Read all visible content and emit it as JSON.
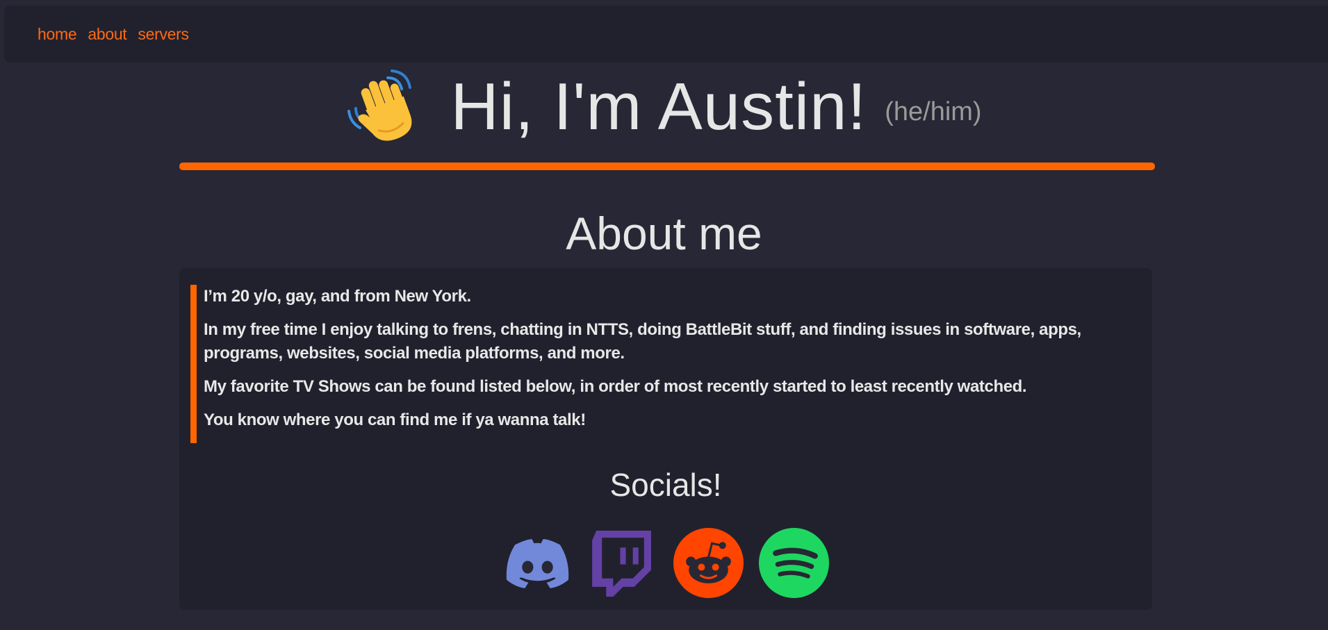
{
  "nav": {
    "items": [
      {
        "label": "home"
      },
      {
        "label": "about"
      },
      {
        "label": "servers"
      }
    ]
  },
  "hero": {
    "title": "Hi, I'm Austin!",
    "pronouns": "(he/him)",
    "emoji_icon": "waving-hand-icon"
  },
  "about": {
    "title": "About me",
    "paragraphs": [
      "I’m 20 y/o, gay, and from New York.",
      "In my free time I enjoy talking to frens, chatting in NTTS, doing BattleBit stuff, and finding issues in software, apps, programs, websites, social media platforms, and more.",
      "My favorite TV Shows can be found listed below, in order of most recently started to least recently watched.",
      "You know where you can find me if ya wanna talk!"
    ]
  },
  "socials": {
    "title": "Socials!",
    "links": [
      {
        "icon": "discord-icon",
        "color": "#7289da"
      },
      {
        "icon": "twitch-icon",
        "color": "#6441a5"
      },
      {
        "icon": "reddit-icon",
        "color": "#ff4500"
      },
      {
        "icon": "spotify-icon",
        "color": "#1ed760"
      }
    ]
  },
  "colors": {
    "accent": "#ff6600",
    "background": "#272735",
    "panel": "#21212e",
    "text": "#e6e6e6",
    "muted": "#9a9a9a"
  }
}
